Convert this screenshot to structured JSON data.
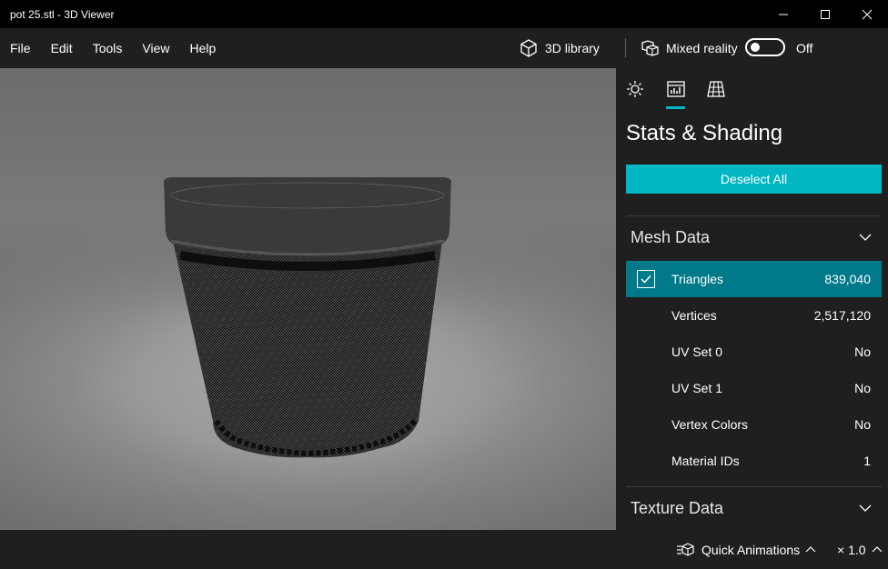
{
  "window": {
    "title": "pot 25.stl - 3D Viewer",
    "controls": [
      "minimize",
      "maximize",
      "close"
    ]
  },
  "menu": {
    "items": [
      "File",
      "Edit",
      "Tools",
      "View",
      "Help"
    ],
    "library_label": "3D library",
    "mixed_reality_label": "Mixed reality",
    "mixed_reality_state": "Off",
    "mixed_reality_on": false
  },
  "panel": {
    "tabs": [
      {
        "icon": "lighting-icon",
        "active": false
      },
      {
        "icon": "stats-icon",
        "active": true
      },
      {
        "icon": "grid-icon",
        "active": false
      }
    ],
    "title": "Stats & Shading",
    "deselect_label": "Deselect All",
    "mesh_section": "Mesh Data",
    "texture_section": "Texture Data",
    "mesh_rows": [
      {
        "label": "Triangles",
        "value": "839,040",
        "checked": true
      },
      {
        "label": "Vertices",
        "value": "2,517,120"
      },
      {
        "label": "UV Set 0",
        "value": "No"
      },
      {
        "label": "UV Set 1",
        "value": "No"
      },
      {
        "label": "Vertex Colors",
        "value": "No"
      },
      {
        "label": "Material IDs",
        "value": "1"
      }
    ]
  },
  "bottom": {
    "animations_label": "Quick Animations",
    "speed_label": "× 1.0"
  },
  "colors": {
    "accent": "#00b7c3",
    "selected_row": "#007a8a",
    "chrome": "#1f1f1f",
    "titlebar": "#000000"
  }
}
